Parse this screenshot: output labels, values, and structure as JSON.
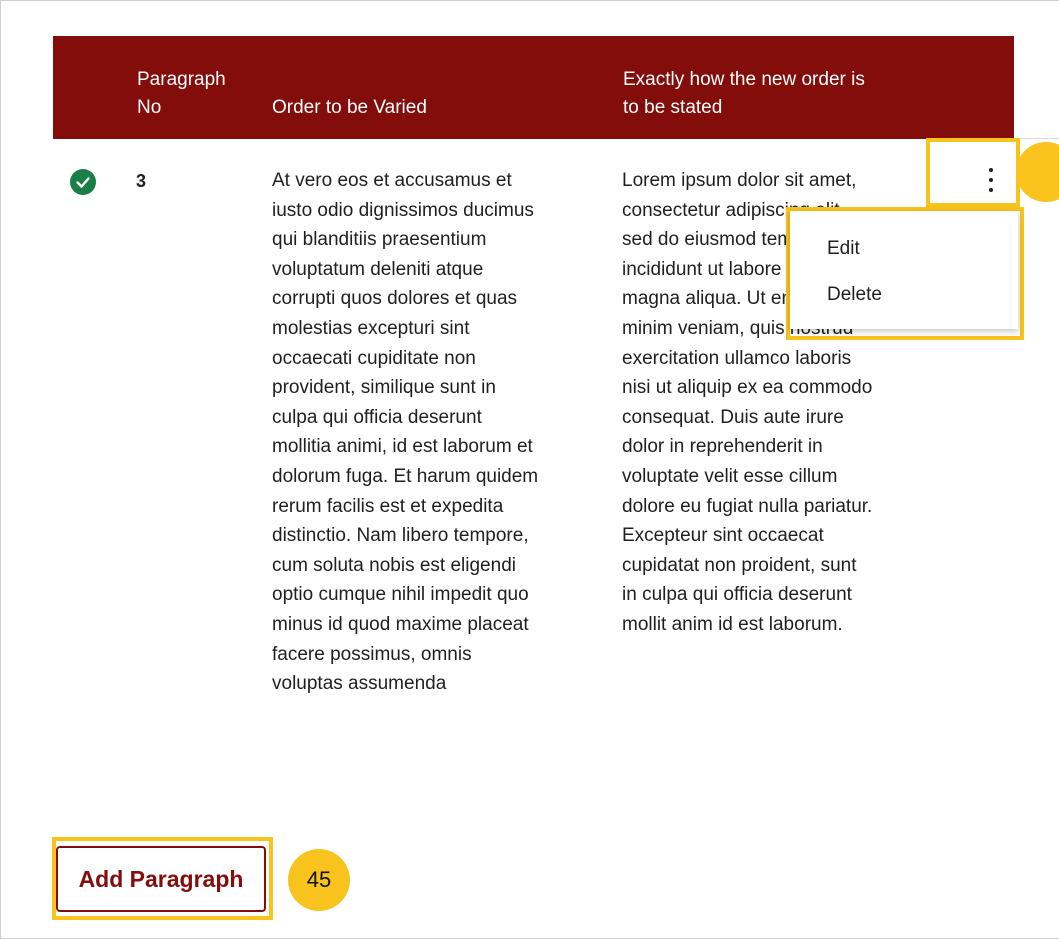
{
  "table": {
    "headers": {
      "paragraph_no": "Paragraph\nNo",
      "order_to_be_varied": "Order to be Varied",
      "new_order": "Exactly how the new order is\nto be stated"
    },
    "rows": [
      {
        "status": "complete",
        "paragraph_no": "3",
        "order_to_be_varied": "At vero eos et accusamus et\niusto odio dignissimos ducimus\nqui blanditiis praesentium\nvoluptatum deleniti atque\ncorrupti quos dolores et quas\nmolestias excepturi sint\noccaecati cupiditate non\nprovident, similique sunt in\nculpa qui officia deserunt\nmollitia animi, id est laborum et\ndolorum fuga. Et harum quidem\nrerum facilis est et expedita\ndistinctio. Nam libero tempore,\ncum soluta nobis est eligendi\noptio cumque nihil impedit quo\nminus id quod maxime placeat\nfacere possimus, omnis\nvoluptas assumenda",
        "new_order": "Lorem ipsum dolor sit amet,\nconsectetur adipiscing elit,\nsed do eiusmod tempor\nincididunt ut labore et dolore\nmagna aliqua. Ut enim ad\nminim veniam, quis nostrud\nexercitation ullamco laboris\nnisi ut aliquip ex ea commodo\nconsequat. Duis aute irure\ndolor in reprehenderit in\nvoluptate velit esse cillum\ndolore eu fugiat nulla pariatur.\nExcepteur sint occaecat\ncupidatat non proident, sunt\nin culpa qui officia deserunt\nmollit anim id est laborum."
      }
    ]
  },
  "row_menu": {
    "items": [
      "Edit",
      "Delete"
    ]
  },
  "add_button": {
    "label": "Add Paragraph"
  },
  "callouts": {
    "add_button": "45"
  },
  "colors": {
    "header_bg": "#820d0a",
    "highlight": "#f8c31c",
    "check_green": "#1a7f46"
  }
}
